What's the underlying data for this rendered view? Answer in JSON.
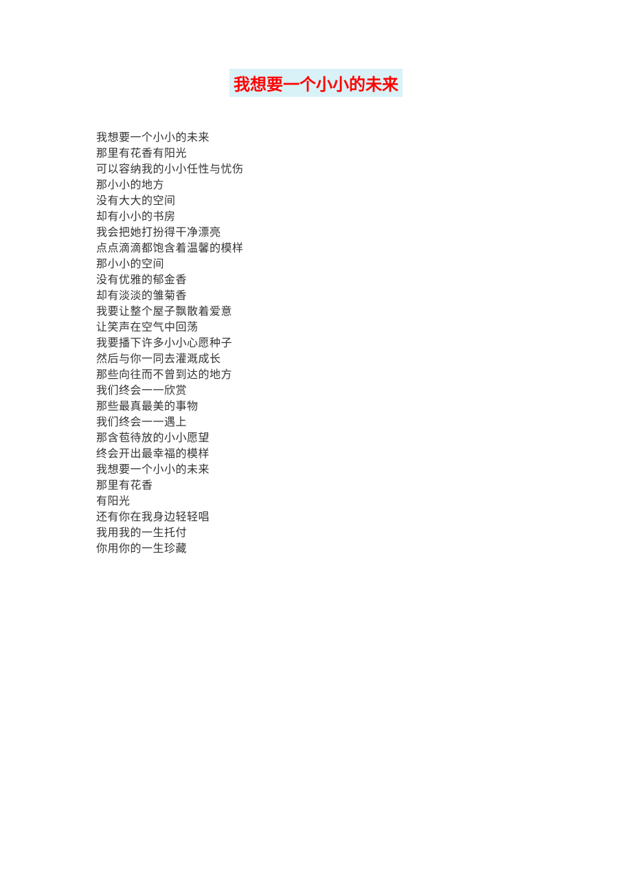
{
  "title": "我想要一个小小的未来",
  "lines": [
    "我想要一个小小的未来",
    "那里有花香有阳光",
    "可以容纳我的小小任性与忧伤",
    "那小小的地方",
    "没有大大的空间",
    "却有小小的书房",
    "我会把她打扮得干净漂亮",
    "点点滴滴都饱含着温馨的模样",
    "那小小的空间",
    "没有优雅的郁金香",
    "却有淡淡的雏菊香",
    "我要让整个屋子飘散着爱意",
    "让笑声在空气中回荡",
    "我要播下许多小小心愿种子",
    "然后与你一同去灌溉成长",
    "那些向往而不曾到达的地方",
    "我们终会一一欣赏",
    "那些最真最美的事物",
    "我们终会一一遇上",
    "那含苞待放的小小愿望",
    "终会开出最幸福的模样",
    "我想要一个小小的未来",
    "那里有花香",
    "有阳光",
    "还有你在我身边轻轻唱",
    "我用我的一生托付",
    "你用你的一生珍藏"
  ]
}
